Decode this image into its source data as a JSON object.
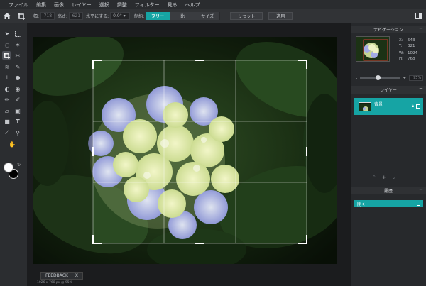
{
  "menu": [
    "ファイル",
    "編集",
    "画像",
    "レイヤー",
    "選択",
    "調整",
    "フィルター",
    "見る",
    "ヘルプ"
  ],
  "options": {
    "width_label": "幅:",
    "width_value": "718",
    "height_label": "高さ:",
    "height_value": "621",
    "level_label": "水平にする:",
    "level_value": "0.0°",
    "constraint_label": "制約:",
    "constraint_options": [
      "フリー",
      "比",
      "サイズ"
    ],
    "reset_label": "リセット",
    "apply_label": "適用"
  },
  "navigation": {
    "title": "ナビゲーション",
    "x_label": "X:",
    "x_value": "543",
    "y_label": "Y:",
    "y_value": "321",
    "w_label": "W:",
    "w_value": "1024",
    "h_label": "H:",
    "h_value": "768",
    "zoom_minus": "-",
    "zoom_plus": "+",
    "zoom_value": "95%",
    "zoom_fraction": 0.45
  },
  "layers": {
    "title": "レイヤー",
    "items": [
      {
        "name": "背景"
      }
    ]
  },
  "history": {
    "title": "履歴",
    "items": [
      {
        "label": "開く"
      }
    ]
  },
  "feedback": {
    "label": "FEEDBACK",
    "close": "X"
  },
  "status": "1026 x 768 px @ 95%",
  "colors": {
    "accent": "#16a4a4",
    "primary_swatch": "#ffffff",
    "secondary_swatch": "#000000"
  }
}
